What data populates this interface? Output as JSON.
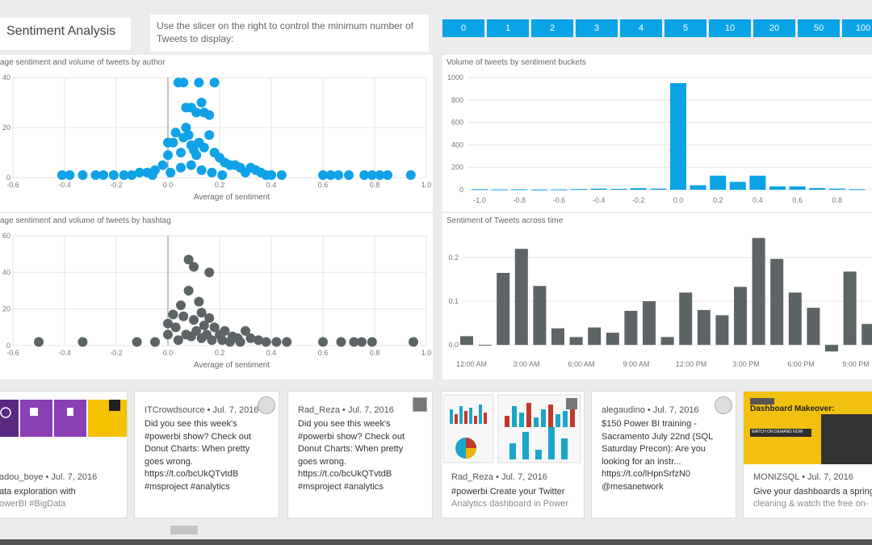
{
  "header": {
    "title": "Sentiment Analysis",
    "instructions": "Use the slicer on the right to control the minimum number of Tweets to display:",
    "slicer": [
      "0",
      "1",
      "2",
      "3",
      "4",
      "5",
      "10",
      "20",
      "50",
      "100"
    ]
  },
  "colors": {
    "accent": "#0aa3e6",
    "scatter_blue": "#10a2e8",
    "gray": "#5d6466"
  },
  "chart_data": [
    {
      "type": "scatter",
      "title": "age sentiment and volume of tweets by author",
      "xlabel": "Average of sentiment",
      "xticks": [
        "-0.6",
        "-0.4",
        "-0.2",
        "0.0",
        "0.2",
        "0.4",
        "0.6",
        "0.8",
        "1.0"
      ],
      "yticks": [
        "0",
        "20",
        "40"
      ],
      "xlim": [
        -0.6,
        1.0
      ],
      "ylim": [
        0,
        40
      ],
      "grid": true,
      "points": [
        [
          -0.41,
          1
        ],
        [
          -0.38,
          1
        ],
        [
          -0.33,
          1
        ],
        [
          -0.28,
          1
        ],
        [
          -0.25,
          1
        ],
        [
          -0.21,
          1
        ],
        [
          -0.17,
          1
        ],
        [
          -0.14,
          1
        ],
        [
          -0.11,
          2
        ],
        [
          -0.08,
          2
        ],
        [
          -0.05,
          3
        ],
        [
          -0.02,
          5
        ],
        [
          0.0,
          9
        ],
        [
          0.0,
          14
        ],
        [
          0.02,
          14
        ],
        [
          0.03,
          18
        ],
        [
          0.05,
          10
        ],
        [
          0.06,
          16
        ],
        [
          0.07,
          20
        ],
        [
          0.08,
          17
        ],
        [
          0.09,
          13
        ],
        [
          0.1,
          11
        ],
        [
          0.11,
          9
        ],
        [
          0.12,
          14
        ],
        [
          0.14,
          12
        ],
        [
          0.16,
          17
        ],
        [
          0.18,
          10
        ],
        [
          0.2,
          8
        ],
        [
          0.22,
          6
        ],
        [
          0.24,
          5
        ],
        [
          0.26,
          5
        ],
        [
          0.28,
          4
        ],
        [
          0.3,
          2
        ],
        [
          0.32,
          4
        ],
        [
          0.34,
          3
        ],
        [
          0.36,
          2
        ],
        [
          0.38,
          1
        ],
        [
          0.4,
          1
        ],
        [
          0.44,
          1
        ],
        [
          0.6,
          1
        ],
        [
          0.63,
          1
        ],
        [
          0.66,
          1
        ],
        [
          0.7,
          1
        ],
        [
          0.76,
          1
        ],
        [
          0.79,
          1
        ],
        [
          0.82,
          1
        ],
        [
          0.85,
          1
        ],
        [
          0.94,
          1
        ],
        [
          0.04,
          38
        ],
        [
          0.06,
          38
        ],
        [
          0.12,
          38
        ],
        [
          0.18,
          38
        ],
        [
          0.09,
          28
        ],
        [
          0.11,
          26
        ],
        [
          0.14,
          26
        ],
        [
          0.13,
          30
        ],
        [
          0.07,
          28
        ],
        [
          0.16,
          25
        ],
        [
          -0.06,
          1
        ],
        [
          0.01,
          2
        ],
        [
          0.05,
          4
        ],
        [
          0.09,
          5
        ],
        [
          0.13,
          3
        ],
        [
          0.17,
          2
        ],
        [
          0.21,
          1
        ]
      ]
    },
    {
      "type": "bar",
      "title": "Volume of tweets by sentiment buckets",
      "xticks": [
        "-1.0",
        "-0.8",
        "-0.6",
        "-0.4",
        "-0.2",
        "0.0",
        "0.2",
        "0.4",
        "0.6",
        "0.8"
      ],
      "yticks": [
        "0",
        "200",
        "400",
        "600",
        "800",
        "1000"
      ],
      "ylim": [
        0,
        1000
      ],
      "x": [
        -1.0,
        -0.9,
        -0.8,
        -0.7,
        -0.6,
        -0.5,
        -0.4,
        -0.3,
        -0.2,
        -0.1,
        0.0,
        0.1,
        0.2,
        0.3,
        0.4,
        0.5,
        0.6,
        0.7,
        0.8,
        0.9
      ],
      "values": [
        5,
        3,
        4,
        2,
        3,
        6,
        10,
        8,
        14,
        10,
        950,
        40,
        125,
        70,
        125,
        30,
        30,
        15,
        10,
        5
      ]
    },
    {
      "type": "scatter",
      "title": "age sentiment and volume of tweets by hashtag",
      "xlabel": "Average of sentiment",
      "xticks": [
        "-0.6",
        "-0.4",
        "-0.2",
        "0.0",
        "0.2",
        "0.4",
        "0.6",
        "0.8",
        "1.0"
      ],
      "yticks": [
        "0",
        "20",
        "40",
        "60"
      ],
      "xlim": [
        -0.6,
        1.0
      ],
      "ylim": [
        0,
        60
      ],
      "grid": true,
      "points": [
        [
          -0.5,
          2
        ],
        [
          -0.33,
          2
        ],
        [
          -0.12,
          2
        ],
        [
          -0.05,
          2
        ],
        [
          0.0,
          6
        ],
        [
          0.0,
          12
        ],
        [
          0.02,
          17
        ],
        [
          0.03,
          10
        ],
        [
          0.05,
          22
        ],
        [
          0.06,
          16
        ],
        [
          0.07,
          6
        ],
        [
          0.08,
          30
        ],
        [
          0.1,
          14
        ],
        [
          0.11,
          8
        ],
        [
          0.12,
          24
        ],
        [
          0.13,
          18
        ],
        [
          0.14,
          11
        ],
        [
          0.15,
          6
        ],
        [
          0.16,
          15
        ],
        [
          0.18,
          10
        ],
        [
          0.2,
          6
        ],
        [
          0.22,
          8
        ],
        [
          0.25,
          5
        ],
        [
          0.27,
          4
        ],
        [
          0.3,
          8
        ],
        [
          0.32,
          4
        ],
        [
          0.35,
          3
        ],
        [
          0.38,
          2
        ],
        [
          0.42,
          2
        ],
        [
          0.46,
          2
        ],
        [
          0.6,
          2
        ],
        [
          0.67,
          2
        ],
        [
          0.72,
          2
        ],
        [
          0.75,
          2
        ],
        [
          0.79,
          2
        ],
        [
          0.95,
          2
        ],
        [
          0.1,
          43
        ],
        [
          0.08,
          47
        ],
        [
          0.16,
          40
        ],
        [
          0.04,
          3
        ],
        [
          0.09,
          5
        ],
        [
          0.13,
          4
        ],
        [
          0.17,
          3
        ],
        [
          0.21,
          3
        ],
        [
          0.24,
          2
        ],
        [
          0.28,
          2
        ]
      ]
    },
    {
      "type": "bar",
      "title": "Sentiment of Tweets across time",
      "xticks": [
        "12:00 AM",
        "3:00 AM",
        "6:00 AM",
        "9:00 AM",
        "12:00 PM",
        "3:00 PM",
        "6:00 PM",
        "9:00 PM"
      ],
      "yticks": [
        "0.0",
        "0.1",
        "0.2"
      ],
      "ylim": [
        -0.02,
        0.25
      ],
      "values": [
        0.02,
        0.0,
        0.165,
        0.22,
        0.135,
        0.038,
        0.018,
        0.04,
        0.028,
        0.078,
        0.1,
        0.018,
        0.12,
        0.08,
        0.068,
        0.133,
        0.245,
        0.197,
        0.12,
        0.085,
        -0.015,
        0.168,
        0.048,
        0.083
      ]
    }
  ],
  "cards": [
    {
      "author": "adou_boye • Jul. 7, 2016",
      "text": "ata exploration with",
      "text2": "owerBI #BigData",
      "image": true
    },
    {
      "author": "ITCrowdsource • Jul. 7, 2016",
      "lines": [
        "Did you see this week's",
        "#powerbi show? Check out",
        "Donut Charts: When pretty",
        "goes wrong.",
        "https://t.co/bcUkQTvtdB",
        "#msproject #analytics"
      ]
    },
    {
      "author": "Rad_Reza • Jul. 7, 2016",
      "lines": [
        "Did you see this week's",
        "#powerbi show? Check out",
        "Donut Charts: When pretty",
        "goes wrong.",
        "https://t.co/bcUkQTvtdB",
        "#msproject #analytics"
      ]
    },
    {
      "author": "Rad_Reza • Jul. 7, 2016",
      "lines": [
        "#powerbi Create your Twitter",
        "Analytics dashboard in Power"
      ],
      "image": true
    },
    {
      "author": "alegaudino • Jul. 7, 2016",
      "lines": [
        "$150 Power BI training -",
        "Sacramento July 22nd (SQL",
        "Saturday Precon): Are you",
        "looking for an instr...",
        "https://t.co/lHpnSrfzN0",
        "@mesanetwork"
      ]
    },
    {
      "author": "MONIZSQL • Jul. 7, 2016",
      "lines": [
        "Give your dashboards a spring",
        "cleaning & watch the free on-"
      ],
      "banner": "Dashboard Makeover:",
      "banner_sub": "WATCH ON DEMAND NOW",
      "image": true
    }
  ]
}
